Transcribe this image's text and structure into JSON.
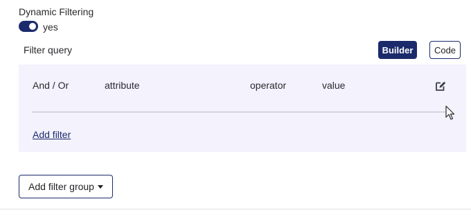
{
  "dynamic_filtering": {
    "label": "Dynamic Filtering",
    "toggle_state": "on",
    "toggle_text": "yes"
  },
  "filter_query": {
    "label": "Filter query",
    "builder_label": "Builder",
    "code_label": "Code",
    "active_mode": "Builder"
  },
  "filter_table": {
    "columns": [
      "And / Or",
      "attribute",
      "operator",
      "value"
    ],
    "edit_icon": "edit-icon",
    "add_filter_label": "Add filter"
  },
  "add_filter_group": {
    "label": "Add filter group",
    "caret_icon": "caret-down-icon"
  },
  "colors": {
    "accent": "#1b2a6b",
    "panel_bg": "#f3f2fd"
  }
}
